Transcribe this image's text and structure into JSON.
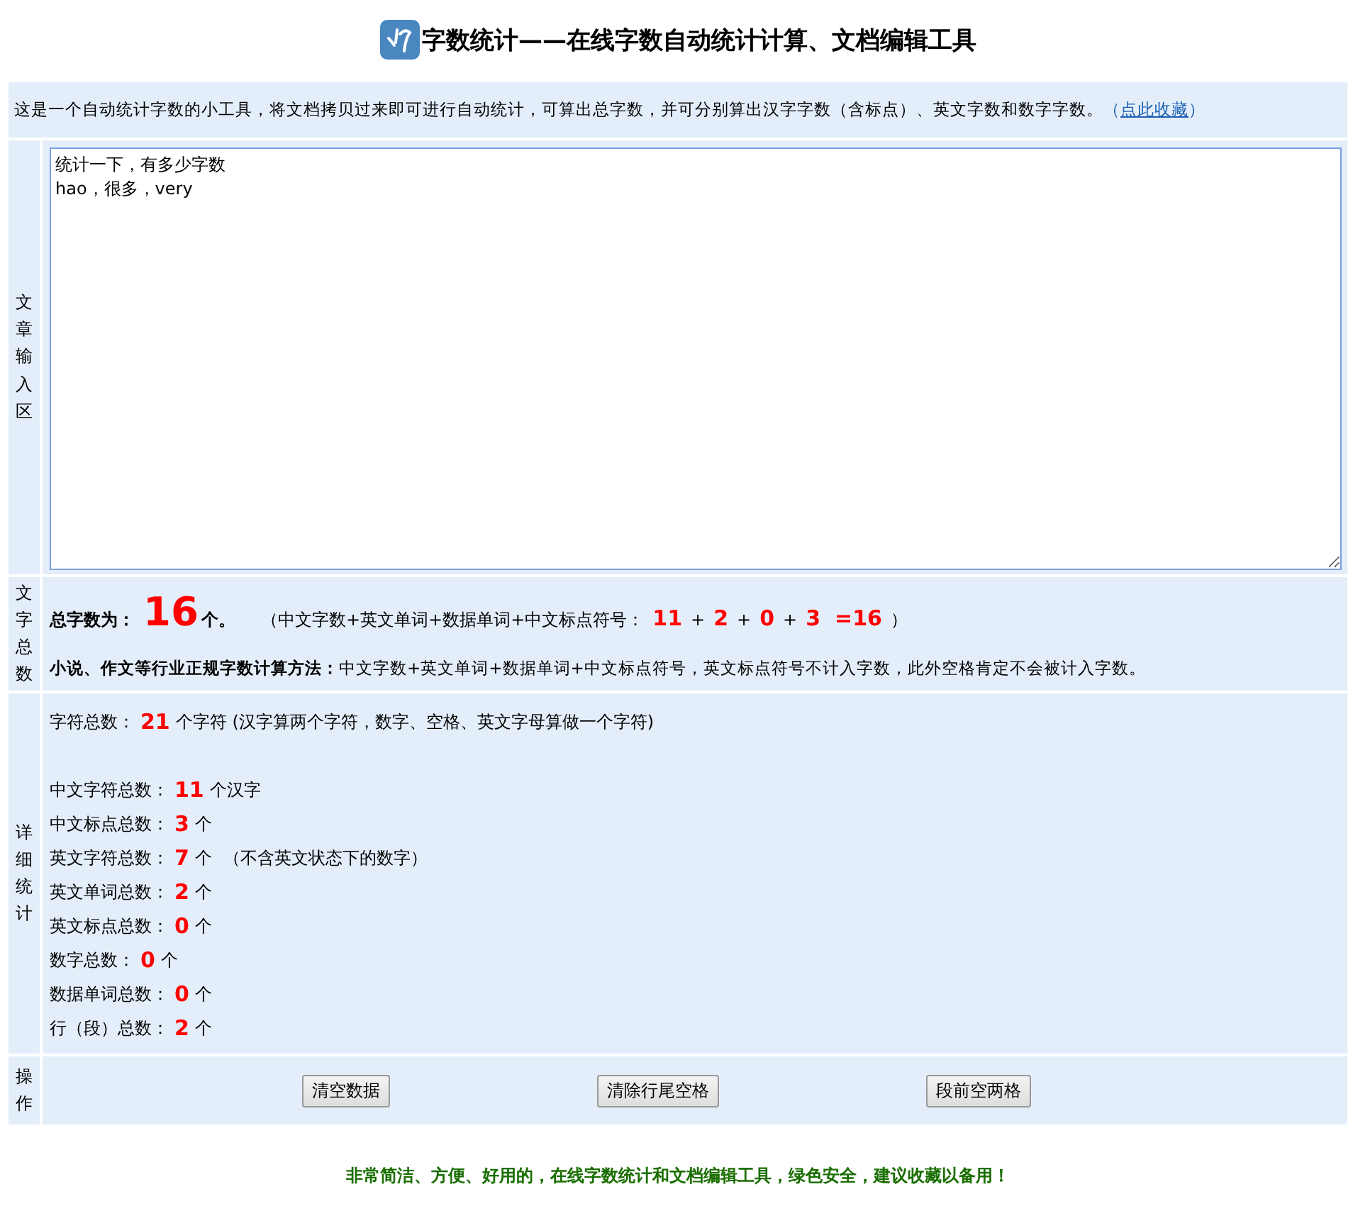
{
  "header": {
    "title": "字数统计——在线字数自动统计计算、文档编辑工具"
  },
  "intro": {
    "text": "这是一个自动统计字数的小工具，将文档拷贝过来即可进行自动统计，可算出总字数，并可分别算出汉字字数（含标点）、英文字数和数字字数。",
    "link_open": "（",
    "link": "点此收藏",
    "link_close": "）"
  },
  "input_section": {
    "label": "文章输入区",
    "value": "统计一下，有多少字数\nhao，很多，very"
  },
  "total_section": {
    "label": "文字总数",
    "total_label": "总字数为：",
    "total_value": "16",
    "total_unit": "个。",
    "formula": [
      {
        "kind": "text",
        "text": "（中文字数+英文单词+数据单词+中文标点符号："
      },
      {
        "kind": "num",
        "text": "11"
      },
      {
        "kind": "text",
        "text": "+"
      },
      {
        "kind": "num",
        "text": "2"
      },
      {
        "kind": "text",
        "text": "+"
      },
      {
        "kind": "num",
        "text": "0"
      },
      {
        "kind": "text",
        "text": "+"
      },
      {
        "kind": "num",
        "text": "3"
      },
      {
        "kind": "num",
        "text": "=16"
      },
      {
        "kind": "text",
        "text": "）"
      }
    ],
    "method_label": "小说、作文等行业正规字数计算方法：",
    "method_text": "中文字数+英文单词+数据单词+中文标点符号，英文标点符号不计入字数，此外空格肯定不会被计入字数。"
  },
  "detail_section": {
    "label": "详细统计",
    "char_total": {
      "label": "字符总数：",
      "value": "21",
      "unit": "个字符 (汉字算两个字符，数字、空格、英文字母算做一个字符)"
    },
    "rows": [
      {
        "label": "中文字符总数：",
        "value": "11",
        "unit": "个汉字"
      },
      {
        "label": "中文标点总数：",
        "value": "3",
        "unit": "个"
      },
      {
        "label": "英文字符总数：",
        "value": "7",
        "unit": "个",
        "note": "（不含英文状态下的数字）"
      },
      {
        "label": "英文单词总数：",
        "value": "2",
        "unit": "个"
      },
      {
        "label": "英文标点总数：",
        "value": "0",
        "unit": "个"
      },
      {
        "label": "数字总数：",
        "value": "0",
        "unit": "个"
      },
      {
        "label": "数据单词总数：",
        "value": "0",
        "unit": "个"
      },
      {
        "label": "行（段）总数：",
        "value": "2",
        "unit": "个"
      }
    ]
  },
  "actions": {
    "label": "操作",
    "buttons": [
      "清空数据",
      "清除行尾空格",
      "段前空两格"
    ]
  },
  "footer": {
    "text": "非常简洁、方便、好用的，在线字数统计和文档编辑工具，绿色安全，建议收藏以备用！"
  }
}
